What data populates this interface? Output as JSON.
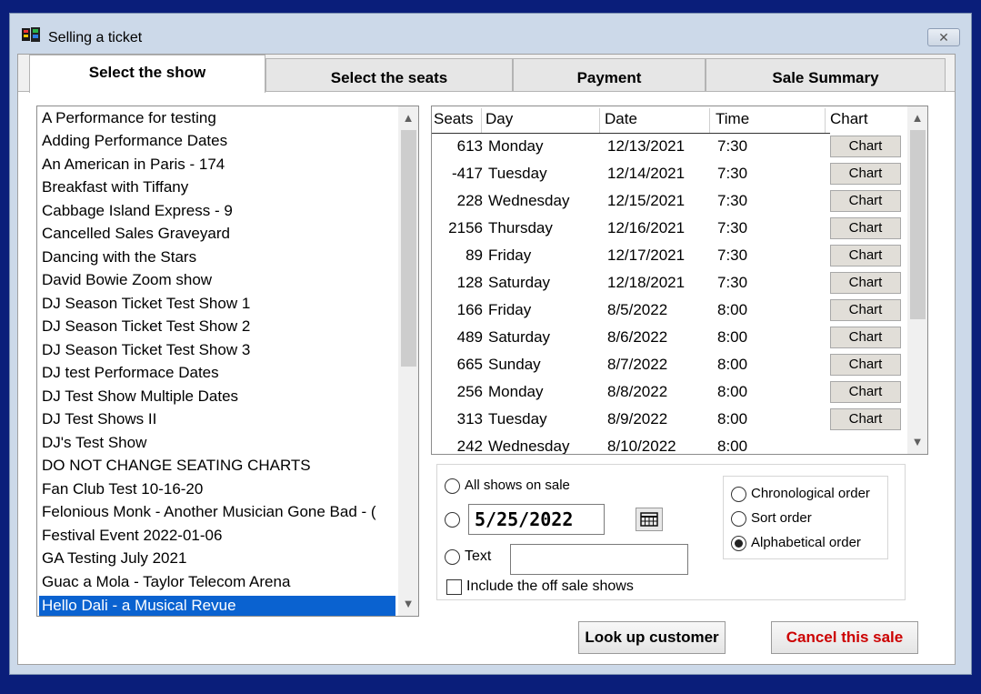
{
  "window": {
    "title": "Selling a ticket",
    "close_glyph": "✕"
  },
  "tabs": [
    {
      "label": "Select the show",
      "active": true
    },
    {
      "label": "Select the seats",
      "active": false
    },
    {
      "label": "Payment",
      "active": false
    },
    {
      "label": "Sale Summary",
      "active": false
    }
  ],
  "shows": [
    "A Performance for testing",
    "Adding Performance Dates",
    "An American in Paris - 174",
    "Breakfast with Tiffany",
    "Cabbage Island Express - 9",
    "Cancelled Sales Graveyard",
    "Dancing with the Stars",
    "David Bowie Zoom show",
    "DJ Season Ticket Test Show 1",
    "DJ Season Ticket Test Show 2",
    "DJ Season Ticket Test Show 3",
    "DJ test Performace Dates",
    "DJ Test Show Multiple Dates",
    "DJ Test Shows II",
    "DJ's Test Show",
    "DO NOT CHANGE SEATING CHARTS",
    "Fan Club Test 10-16-20",
    "Felonious Monk - Another Musician Gone Bad - (",
    "Festival Event 2022-01-06",
    "GA Testing July 2021",
    "Guac a Mola - Taylor Telecom Arena",
    "Hello Dali - a Musical Revue"
  ],
  "selected_show": "Hello Dali - a Musical Revue",
  "performances": {
    "headers": {
      "seats": "Seats",
      "day": "Day",
      "date": "Date",
      "time": "Time",
      "chart": "Chart"
    },
    "chart_button_label": "Chart",
    "rows": [
      {
        "seats": "613",
        "day": "Monday",
        "date": "12/13/2021",
        "time": "7:30"
      },
      {
        "seats": "-417",
        "day": "Tuesday",
        "date": "12/14/2021",
        "time": "7:30"
      },
      {
        "seats": "228",
        "day": "Wednesday",
        "date": "12/15/2021",
        "time": "7:30"
      },
      {
        "seats": "2156",
        "day": "Thursday",
        "date": "12/16/2021",
        "time": "7:30"
      },
      {
        "seats": "89",
        "day": "Friday",
        "date": "12/17/2021",
        "time": "7:30"
      },
      {
        "seats": "128",
        "day": "Saturday",
        "date": "12/18/2021",
        "time": "7:30"
      },
      {
        "seats": "166",
        "day": "Friday",
        "date": "8/5/2022",
        "time": "8:00"
      },
      {
        "seats": "489",
        "day": "Saturday",
        "date": "8/6/2022",
        "time": "8:00"
      },
      {
        "seats": "665",
        "day": "Sunday",
        "date": "8/7/2022",
        "time": "8:00"
      },
      {
        "seats": "256",
        "day": "Monday",
        "date": "8/8/2022",
        "time": "8:00"
      },
      {
        "seats": "313",
        "day": "Tuesday",
        "date": "8/9/2022",
        "time": "8:00"
      },
      {
        "seats": "242",
        "day": "Wednesday",
        "date": "8/10/2022",
        "time": "8:00"
      }
    ]
  },
  "filter": {
    "all_shows_label": "All shows on sale",
    "date_value": "5/25/2022",
    "text_label": "Text",
    "text_value": "",
    "include_off_sale_label": "Include the off sale shows",
    "include_off_sale_checked": false
  },
  "order": {
    "options": [
      "Chronological order",
      "Sort order",
      "Alphabetical order"
    ],
    "selected": "Alphabetical order"
  },
  "buttons": {
    "look_up_customer": "Look up customer",
    "cancel_sale": "Cancel this sale"
  },
  "colors": {
    "selection": "#0a62d0",
    "cancel_text": "#cc0000",
    "desktop": "#0a1e7a"
  },
  "icons": {
    "app": "theater-masks-icon",
    "calendar": "calendar-icon",
    "close": "close-icon"
  }
}
